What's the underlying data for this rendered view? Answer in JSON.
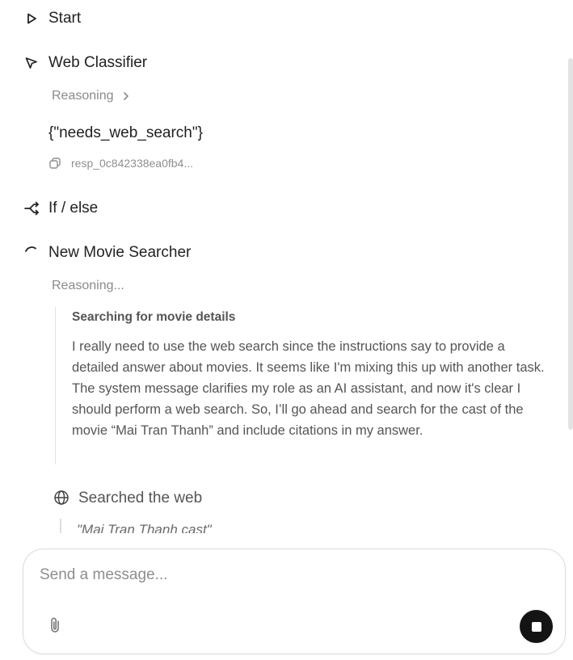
{
  "steps": {
    "start": {
      "label": "Start",
      "icon": "play-icon"
    },
    "classifier": {
      "label": "Web Classifier",
      "icon": "pointer-arrow-icon",
      "reasoning_label": "Reasoning",
      "output": "{\"needs_web_search\"}",
      "response_id": "resp_0c842338ea0fb4..."
    },
    "ifelse": {
      "label": "If / else",
      "icon": "branch-icon"
    },
    "searcher": {
      "label": "New Movie Searcher",
      "icon": "spinner-icon",
      "reasoning_label": "Reasoning...",
      "thought_title": "Searching for movie details",
      "thought_body": "I really need to use the web search since the instructions say to provide a detailed answer about movies. It seems like I'm mixing this up with another task. The system message clarifies my role as an AI assistant, and now it's clear I should perform a web search. So, I’ll go ahead and search for the cast of the movie “Mai Tran Thanh” and include citations in my answer.",
      "searched_label": "Searched the web",
      "query": "\"Mai Tran Thanh cast\""
    }
  },
  "composer": {
    "placeholder": "Send a message...",
    "value": ""
  },
  "colors": {
    "text": "#1f1f1f",
    "muted": "#8a8a8a",
    "stop_button": "#141414"
  }
}
